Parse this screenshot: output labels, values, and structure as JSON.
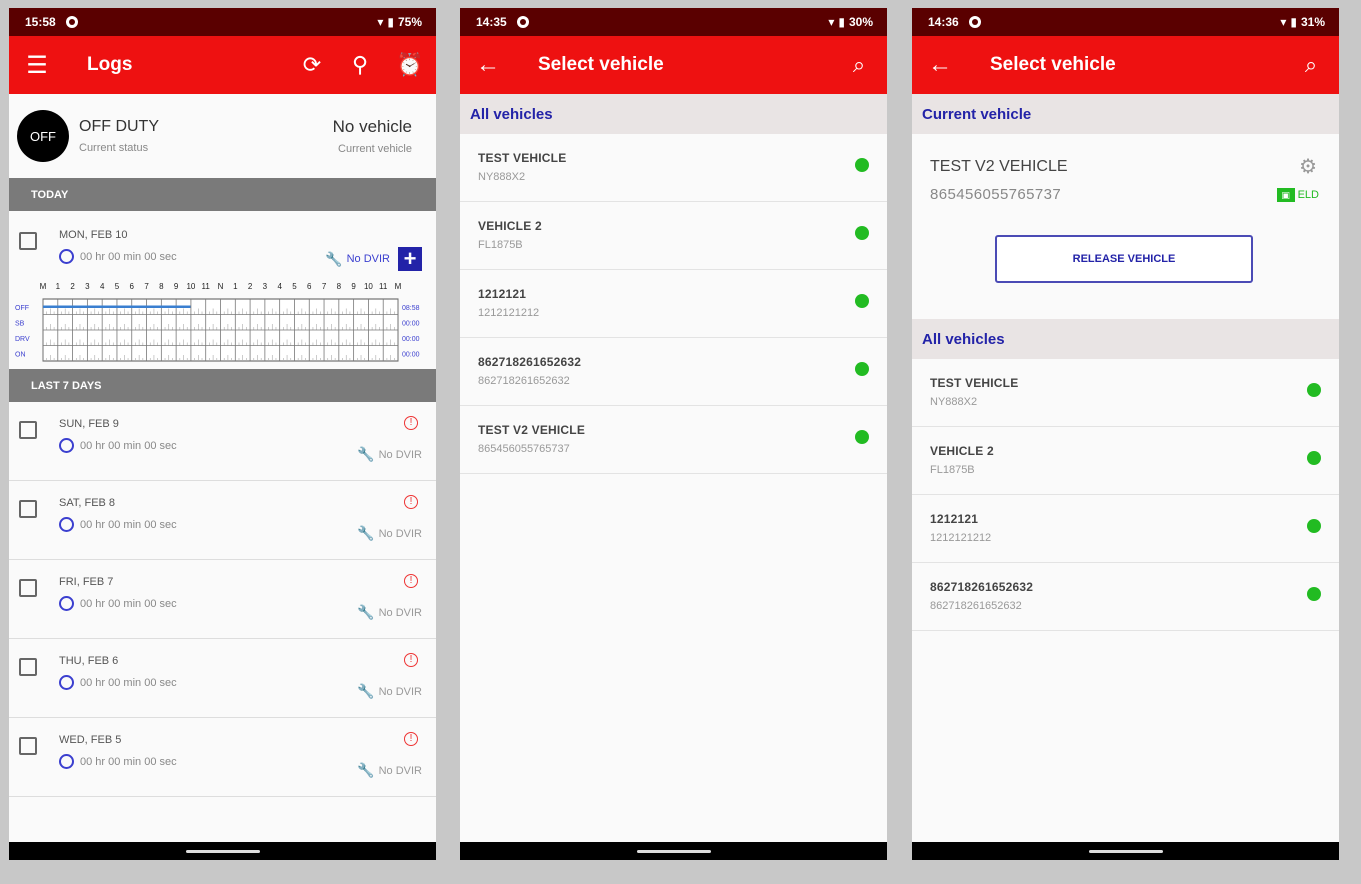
{
  "phones": {
    "logs": {
      "status_time": "15:58",
      "battery": "75%",
      "title": "Logs",
      "duty_badge": "OFF",
      "duty_status": "OFF DUTY",
      "duty_status_sub": "Current status",
      "vehicle": "No vehicle",
      "vehicle_sub": "Current vehicle",
      "today_header": "TODAY",
      "today": {
        "date": "MON, FEB 10",
        "time": "00 hr  00 min  00 sec",
        "dvir": "No DVIR"
      },
      "graph": {
        "hours": [
          "M",
          "1",
          "2",
          "3",
          "4",
          "5",
          "6",
          "7",
          "8",
          "9",
          "10",
          "11",
          "N",
          "1",
          "2",
          "3",
          "4",
          "5",
          "6",
          "7",
          "8",
          "9",
          "10",
          "11",
          "M"
        ],
        "rows": [
          "OFF",
          "SB",
          "DRV",
          "ON"
        ],
        "totals": [
          "08:58",
          "00:00",
          "00:00",
          "00:00"
        ],
        "off_duty_hours": 9.97
      },
      "last7_header": "LAST 7 DAYS",
      "days": [
        {
          "date": "SUN, FEB 9",
          "time": "00 hr  00 min  00 sec",
          "dvir": "No DVIR"
        },
        {
          "date": "SAT, FEB 8",
          "time": "00 hr  00 min  00 sec",
          "dvir": "No DVIR"
        },
        {
          "date": "FRI, FEB 7",
          "time": "00 hr  00 min  00 sec",
          "dvir": "No DVIR"
        },
        {
          "date": "THU, FEB 6",
          "time": "00 hr  00 min  00 sec",
          "dvir": "No DVIR"
        },
        {
          "date": "WED, FEB 5",
          "time": "00 hr  00 min  00 sec",
          "dvir": "No DVIR"
        }
      ]
    },
    "select1": {
      "status_time": "14:35",
      "battery": "30%",
      "title": "Select vehicle",
      "all_header": "All vehicles",
      "vehicles": [
        {
          "name": "TEST VEHICLE",
          "plate": "NY888X2"
        },
        {
          "name": "VEHICLE 2",
          "plate": "FL1875B"
        },
        {
          "name": "1212121",
          "plate": "1212121212"
        },
        {
          "name": "862718261652632",
          "plate": "862718261652632"
        },
        {
          "name": "TEST V2 VEHICLE",
          "plate": "865456055765737"
        }
      ]
    },
    "select2": {
      "status_time": "14:36",
      "battery": "31%",
      "title": "Select vehicle",
      "current_header": "Current vehicle",
      "current": {
        "name": "TEST V2 VEHICLE",
        "plate": "865456055765737",
        "eld": "ELD"
      },
      "release_label": "RELEASE VEHICLE",
      "all_header": "All vehicles",
      "vehicles": [
        {
          "name": "TEST VEHICLE",
          "plate": "NY888X2"
        },
        {
          "name": "VEHICLE 2",
          "plate": "FL1875B"
        },
        {
          "name": "1212121",
          "plate": "1212121212"
        },
        {
          "name": "862718261652632",
          "plate": "862718261652632"
        }
      ]
    }
  },
  "colors": {
    "toolbar": "#ee1111",
    "statusbar": "#5a0000",
    "accent": "#2323a8",
    "online": "#22bb22"
  },
  "icons": {
    "menu": "menu-icon",
    "sync": "sync-icon",
    "location": "location-pin-icon",
    "alarm": "alarm-clock-icon",
    "back": "arrow-back-icon",
    "search": "search-icon"
  }
}
